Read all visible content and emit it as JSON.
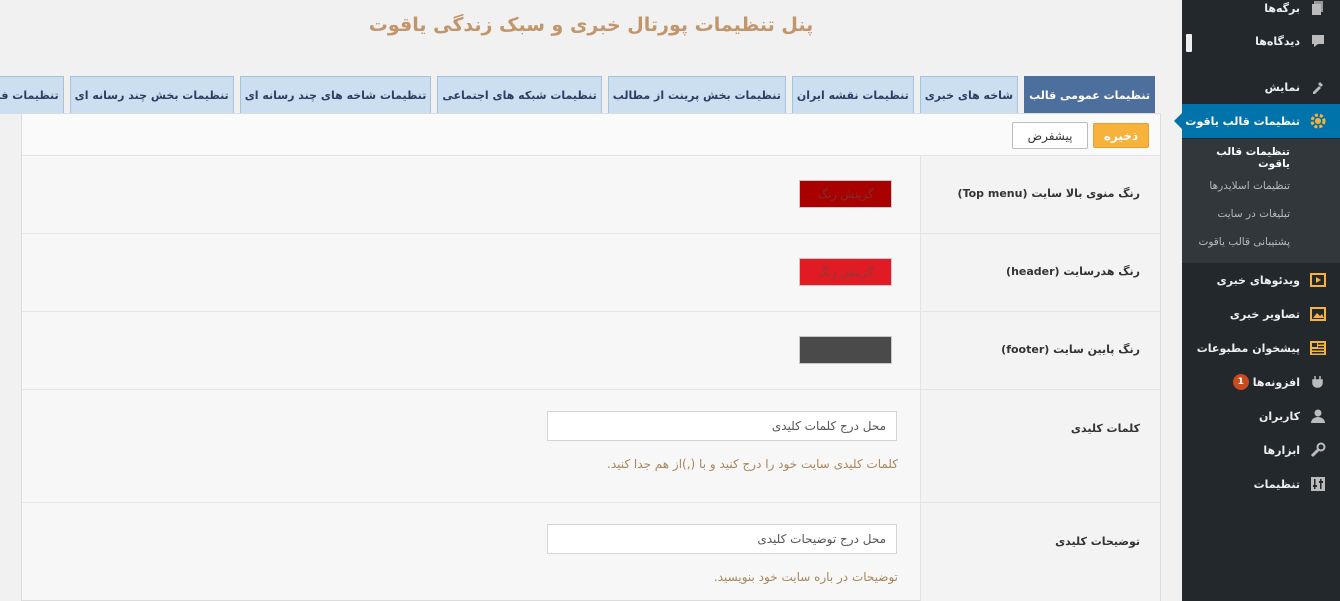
{
  "page": {
    "title": "پنل تنظیمات پورتال خبری و سبک زندگی یاقوت"
  },
  "tabs": [
    {
      "label": "تنظیمات عمومی قالب",
      "active": true
    },
    {
      "label": "شاخه های خبری",
      "active": false
    },
    {
      "label": "تنظیمات نقشه ایران",
      "active": false
    },
    {
      "label": "تنظیمات بخش پرینت از مطالب",
      "active": false
    },
    {
      "label": "تنظیمات شبکه های اجتماعی",
      "active": false
    },
    {
      "label": "تنظیمات شاخه های چند رسانه ای",
      "active": false
    },
    {
      "label": "تنظیمات بخش چند رسانه ای",
      "active": false
    },
    {
      "label": "تنظیمات فید خبرها",
      "active": false
    }
  ],
  "toolbar": {
    "save_label": "ذخیره",
    "default_label": "پیشفرض"
  },
  "settings": {
    "top_menu": {
      "label": "رنگ منوی بالا سایت (Top menu)",
      "swatch_text": "گزینش رنگ",
      "color": "#a90000"
    },
    "header": {
      "label": "رنگ هدرسایت (header)",
      "swatch_text": "گزینش رنگ",
      "color": "#e01b24"
    },
    "footer": {
      "label": "رنگ پایین سایت (footer)",
      "swatch_text": "",
      "color": "#4a4a4a"
    },
    "keywords": {
      "label": "کلمات کلیدی",
      "placeholder": "محل درج کلمات کلیدی",
      "hint": "کلمات کلیدی سایت خود را درج کنید و با (,)از هم جدا کنید."
    },
    "description": {
      "label": "توضیحات کلیدی",
      "placeholder": "محل درج توضیحات کلیدی",
      "hint": "توضیحات در باره سایت خود بنویسید."
    }
  },
  "sidebar": {
    "items": [
      {
        "label": "برگه‌ها",
        "icon": "pages-icon"
      },
      {
        "label": "دیدگاه‌ها",
        "icon": "comments-icon"
      },
      {
        "label": "نمایش",
        "icon": "appearance-icon"
      },
      {
        "label": "تنظیمات قالب یاقوت",
        "icon": "gear-icon"
      },
      {
        "label": "ویدئوهای خبری",
        "icon": "video-icon"
      },
      {
        "label": "تصاویر خبری",
        "icon": "image-icon"
      },
      {
        "label": "پیشخوان مطبوعات",
        "icon": "newspaper-icon"
      },
      {
        "label": "افزونه‌ها",
        "icon": "plugin-icon",
        "badge": "1"
      },
      {
        "label": "کاربران",
        "icon": "users-icon"
      },
      {
        "label": "ابزارها",
        "icon": "tools-icon"
      },
      {
        "label": "تنظیمات",
        "icon": "settings-icon"
      }
    ],
    "submenu": [
      {
        "label": "تنظیمات قالب یاقوت",
        "current": true
      },
      {
        "label": "تنظیمات اسلایدرها",
        "current": false
      },
      {
        "label": "تبلیغات در سایت",
        "current": false
      },
      {
        "label": "پشتیبانی قالب یاقوت",
        "current": false
      }
    ]
  },
  "colors": {
    "accent": "#0073aa",
    "tab_active": "#4d6f9e",
    "tab_inactive": "#ccdff0",
    "title": "#c2956b",
    "save_button": "#f6b23a"
  }
}
